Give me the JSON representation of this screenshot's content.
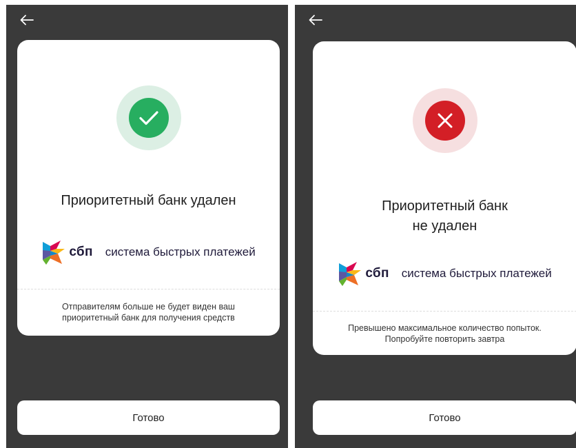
{
  "colors": {
    "screen_bg": "#3a3a3a",
    "success": "#27ae60",
    "success_halo": "#dcefe4",
    "error": "#d31f26",
    "error_halo": "#f6dfe0",
    "sbp_text": "#1f1a3a"
  },
  "screens": [
    {
      "back_icon": "arrow-left-icon",
      "status_icon": "checkmark-icon",
      "title_lines": [
        "Приоритетный банк удален"
      ],
      "sbp": {
        "abbr": "сбп",
        "full": "система быстрых платежей"
      },
      "note_lines": [
        "Отправителям больше не будет виден ваш",
        "приоритетный банк для получения средств"
      ],
      "button_label": "Готово"
    },
    {
      "back_icon": "arrow-left-icon",
      "status_icon": "cross-icon",
      "title_lines": [
        "Приоритетный банк",
        "не удален"
      ],
      "sbp": {
        "abbr": "сбп",
        "full": "система быстрых платежей"
      },
      "note_lines": [
        "Превышено максимальное количество попыток.",
        "Попробуйте повторить завтра"
      ],
      "button_label": "Готово"
    }
  ]
}
